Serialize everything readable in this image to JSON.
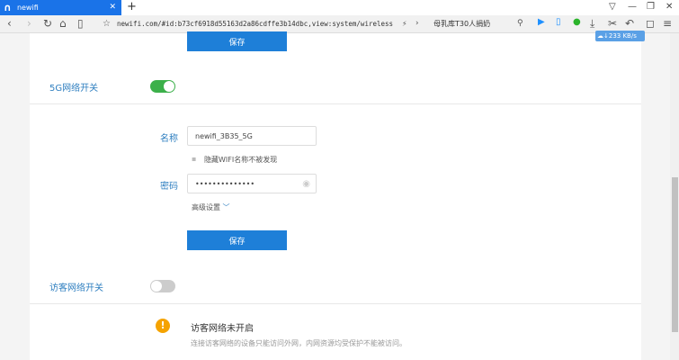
{
  "browser": {
    "tab_title": "newifi",
    "url": "newifi.com/#id:b73cf6918d55163d2a86cdffe3b14dbc,view:system/wireless",
    "search_text": "母乳库T30人捐奶",
    "speed": "233 KB/s"
  },
  "page": {
    "top_save": "保存",
    "wifi5g_label": "5G网络开关",
    "wifi5g_on": true,
    "name_label": "名称",
    "name_value": "newifi_3B35_5G",
    "hide_label": "隐藏WIFI名称不被发现",
    "password_label": "密码",
    "password_value": "••••••••••••••",
    "advanced_label": "高级设置",
    "save": "保存",
    "guest_label": "访客网络开关",
    "guest_on": false,
    "guest_title": "访客网络未开启",
    "guest_desc": "连接访客网络的设备只能访问外网，内网资源均受保护不能被访问。"
  },
  "colors": {
    "accent": "#1e7fd8",
    "toggle_on": "#3cb04a",
    "warning": "#f5a300"
  }
}
